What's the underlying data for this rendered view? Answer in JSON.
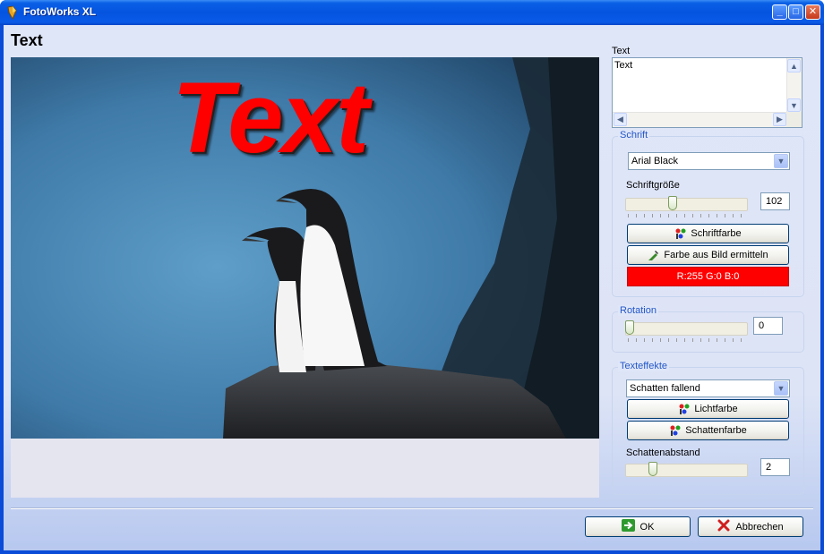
{
  "window": {
    "title": "FotoWorks XL",
    "minimize": "_",
    "maximize": "□",
    "close": "✕"
  },
  "page": {
    "title": "Text"
  },
  "preview": {
    "overlay_text": "Text"
  },
  "text_field": {
    "label": "Text",
    "value": "Text"
  },
  "font_group": {
    "title": "Schrift",
    "font_value": "Arial Black",
    "size_label": "Schriftgröße",
    "size_value": "102",
    "size_slider_fraction": 0.35,
    "font_color_button": "Schriftfarbe",
    "pick_color_button": "Farbe aus Bild ermitteln",
    "color_readout": "R:255  G:0  B:0",
    "color_hex": "#ff0000"
  },
  "rotation_group": {
    "title": "Rotation",
    "value": "0",
    "slider_fraction": 0.0
  },
  "effects_group": {
    "title": "Texteffekte",
    "effect_value": "Schatten fallend",
    "light_color_button": "Lichtfarbe",
    "shadow_color_button": "Schattenfarbe",
    "distance_label": "Schattenabstand",
    "distance_value": "2",
    "distance_slider_fraction": 0.2
  },
  "footer": {
    "ok_label": "OK",
    "cancel_label": "Abbrechen"
  }
}
